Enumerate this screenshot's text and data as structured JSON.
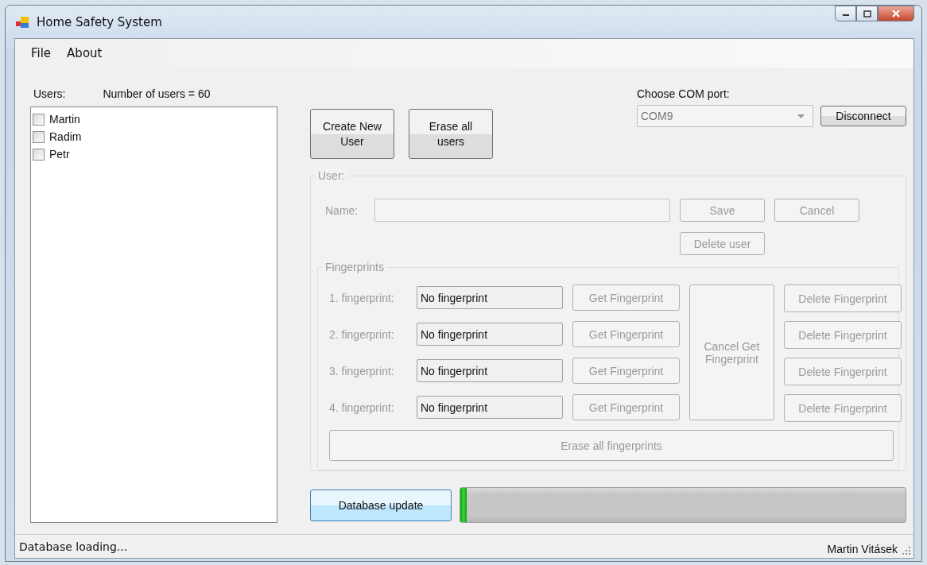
{
  "window": {
    "title": "Home Safety System"
  },
  "menu": [
    {
      "label": "File"
    },
    {
      "label": "About"
    }
  ],
  "users_label": "Users:",
  "user_count": "Number of users = 60",
  "users": [
    {
      "name": "Martin",
      "checked": false
    },
    {
      "name": "Radim",
      "checked": false
    },
    {
      "name": "Petr",
      "checked": false
    }
  ],
  "create_button": "Create New User",
  "erase_users_button": "Erase all users",
  "com_port": {
    "label": "Choose COM port:",
    "value": "COM9",
    "disabled": true,
    "button": "Disconnect"
  },
  "user_group": {
    "title": "User:",
    "disabled": true,
    "name_label": "Name:",
    "save": "Save",
    "cancel": "Cancel",
    "delete": "Delete user"
  },
  "fingerprints": {
    "title": "Fingerprints",
    "rows": [
      {
        "label": "1. fingerprint:",
        "value": "No fingerprint",
        "get": "Get Fingerprint",
        "delete": "Delete Fingerprint"
      },
      {
        "label": "2. fingerprint:",
        "value": "No fingerprint",
        "get": "Get Fingerprint",
        "delete": "Delete Fingerprint"
      },
      {
        "label": "3. fingerprint:",
        "value": "No fingerprint",
        "get": "Get Fingerprint",
        "delete": "Delete Fingerprint"
      },
      {
        "label": "4. fingerprint:",
        "value": "No fingerprint",
        "get": "Get Fingerprint",
        "delete": "Delete Fingerprint"
      }
    ],
    "cancel": "Cancel Get Fingerprint",
    "erase": "Erase all fingerprints"
  },
  "database_update": "Database update",
  "progress": {
    "level": 0.015
  },
  "status_bar": {
    "left": "Database loading...",
    "right": "Martin Vitásek"
  }
}
